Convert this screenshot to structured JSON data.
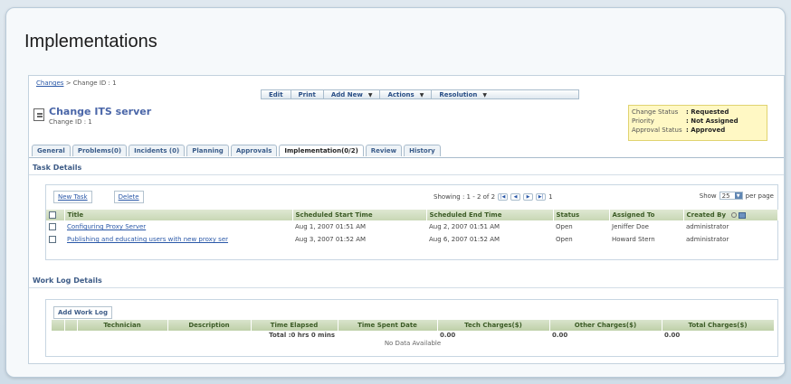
{
  "page": {
    "heading": "Implementations"
  },
  "breadcrumb": {
    "root": "Changes",
    "separator": ">",
    "current": "Change ID : 1"
  },
  "toolbar": {
    "edit": "Edit",
    "print": "Print",
    "add_new": "Add New",
    "actions": "Actions",
    "resolution": "Resolution"
  },
  "change": {
    "title": "Change ITS server",
    "id_label": "Change ID : 1"
  },
  "status": {
    "rows": [
      {
        "label": "Change Status",
        "value": ": Requested"
      },
      {
        "label": "Priority",
        "value": ": Not Assigned"
      },
      {
        "label": "Approval Status",
        "value": ": Approved"
      }
    ]
  },
  "tabs": [
    "General",
    "Problems(0)",
    "Incidents (0)",
    "Planning",
    "Approvals",
    "Implementation(0/2)",
    "Review",
    "History"
  ],
  "task_details": {
    "title": "Task Details",
    "new_task": "New Task",
    "delete": "Delete",
    "showing": "Showing : 1 - 2 of 2",
    "page_num": "1",
    "show_label": "Show",
    "show_value": "25",
    "per_page": "per page",
    "columns": [
      "Title",
      "Scheduled Start Time",
      "Scheduled End Time",
      "Status",
      "Assigned To",
      "Created By"
    ],
    "rows": [
      {
        "title": "Configuring Proxy Server",
        "start": "Aug 1, 2007 01:51 AM",
        "end": "Aug 2, 2007 01:51 AM",
        "status": "Open",
        "assigned": "Jeniffer Doe",
        "created": "administrator"
      },
      {
        "title": "Publishing and educating users with new proxy ser",
        "start": "Aug 3, 2007 01:52 AM",
        "end": "Aug 6, 2007 01:52 AM",
        "status": "Open",
        "assigned": "Howard Stern",
        "created": "administrator"
      }
    ]
  },
  "work_log": {
    "title": "Work Log Details",
    "add_button": "Add Work Log",
    "columns": [
      "Technician",
      "Description",
      "Time Elapsed",
      "Time Spent Date",
      "Tech Charges($)",
      "Other Charges($)",
      "Total Charges($)"
    ],
    "total_label": "Total :0 hrs 0 mins",
    "tech_total": "0.00",
    "other_total": "0.00",
    "grand_total": "0.00",
    "no_data": "No Data Available"
  }
}
